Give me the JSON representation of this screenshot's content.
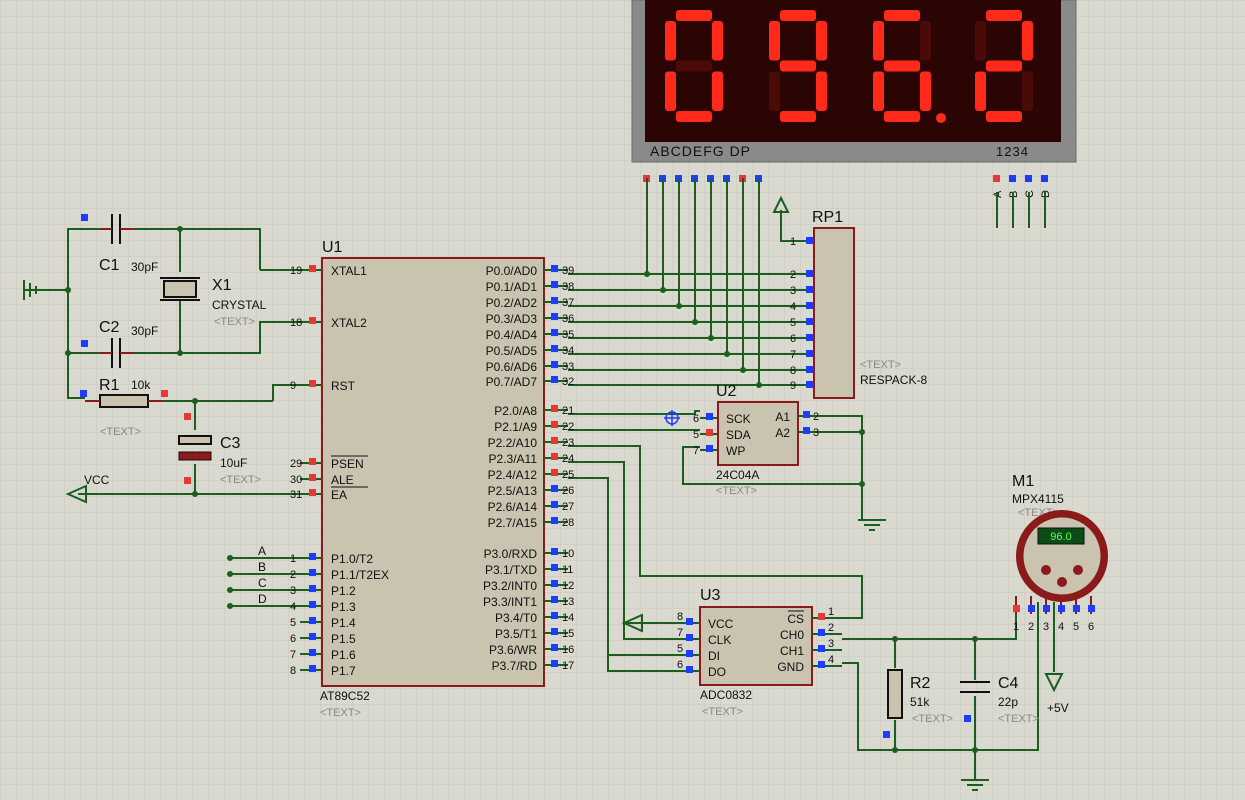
{
  "display": {
    "digits": [
      "0",
      "9",
      "6",
      "2"
    ],
    "seg_labels": "ABCDEFG  DP",
    "digit_labels": "1234",
    "com_pins": [
      "A",
      "B",
      "C",
      "D"
    ]
  },
  "u1": {
    "ref": "U1",
    "part": "AT89C52",
    "text": "<TEXT>",
    "left_pins": [
      {
        "num": "19",
        "name": "XTAL1"
      },
      {
        "num": "18",
        "name": "XTAL2"
      },
      {
        "num": "9",
        "name": "RST"
      },
      {
        "num": "29",
        "name": "PSEN"
      },
      {
        "num": "30",
        "name": "ALE"
      },
      {
        "num": "31",
        "name": "EA"
      },
      {
        "num": "1",
        "name": "P1.0/T2"
      },
      {
        "num": "2",
        "name": "P1.1/T2EX"
      },
      {
        "num": "3",
        "name": "P1.2"
      },
      {
        "num": "4",
        "name": "P1.3"
      },
      {
        "num": "5",
        "name": "P1.4"
      },
      {
        "num": "6",
        "name": "P1.5"
      },
      {
        "num": "7",
        "name": "P1.6"
      },
      {
        "num": "8",
        "name": "P1.7"
      }
    ],
    "right_pins": [
      {
        "num": "39",
        "name": "P0.0/AD0"
      },
      {
        "num": "38",
        "name": "P0.1/AD1"
      },
      {
        "num": "37",
        "name": "P0.2/AD2"
      },
      {
        "num": "36",
        "name": "P0.3/AD3"
      },
      {
        "num": "35",
        "name": "P0.4/AD4"
      },
      {
        "num": "34",
        "name": "P0.5/AD5"
      },
      {
        "num": "33",
        "name": "P0.6/AD6"
      },
      {
        "num": "32",
        "name": "P0.7/AD7"
      },
      {
        "num": "21",
        "name": "P2.0/A8"
      },
      {
        "num": "22",
        "name": "P2.1/A9"
      },
      {
        "num": "23",
        "name": "P2.2/A10"
      },
      {
        "num": "24",
        "name": "P2.3/A11"
      },
      {
        "num": "25",
        "name": "P2.4/A12"
      },
      {
        "num": "26",
        "name": "P2.5/A13"
      },
      {
        "num": "27",
        "name": "P2.6/A14"
      },
      {
        "num": "28",
        "name": "P2.7/A15"
      },
      {
        "num": "10",
        "name": "P3.0/RXD"
      },
      {
        "num": "11",
        "name": "P3.1/TXD"
      },
      {
        "num": "12",
        "name": "P3.2/INT0"
      },
      {
        "num": "13",
        "name": "P3.3/INT1"
      },
      {
        "num": "14",
        "name": "P3.4/T0"
      },
      {
        "num": "15",
        "name": "P3.5/T1"
      },
      {
        "num": "16",
        "name": "P3.6/WR"
      },
      {
        "num": "17",
        "name": "P3.7/RD"
      }
    ]
  },
  "p1_nets": [
    "A",
    "B",
    "C",
    "D"
  ],
  "x1": {
    "ref": "X1",
    "part": "CRYSTAL",
    "text": "<TEXT>"
  },
  "c1": {
    "ref": "C1",
    "value": "30pF"
  },
  "c2": {
    "ref": "C2",
    "value": "30pF"
  },
  "r1": {
    "ref": "R1",
    "value": "10k",
    "text": "<TEXT>"
  },
  "c3": {
    "ref": "C3",
    "value": "10uF",
    "text": "<TEXT>"
  },
  "vcc_label": "VCC",
  "rp1": {
    "ref": "RP1",
    "part": "RESPACK-8",
    "text": "<TEXT>",
    "pins": [
      "1",
      "2",
      "3",
      "4",
      "5",
      "6",
      "7",
      "8",
      "9"
    ]
  },
  "u2": {
    "ref": "U2",
    "part": "24C04A",
    "text": "<TEXT>",
    "left_pins": [
      {
        "num": "6",
        "name": "SCK"
      },
      {
        "num": "5",
        "name": "SDA"
      },
      {
        "num": "7",
        "name": "WP"
      }
    ],
    "right_pins": [
      {
        "num": "2",
        "name": "A1"
      },
      {
        "num": "3",
        "name": "A2"
      }
    ]
  },
  "u3": {
    "ref": "U3",
    "part": "ADC0832",
    "text": "<TEXT>",
    "left_pins": [
      {
        "num": "8",
        "name": "VCC"
      },
      {
        "num": "7",
        "name": "CLK"
      },
      {
        "num": "5",
        "name": "DI"
      },
      {
        "num": "6",
        "name": "DO"
      }
    ],
    "right_pins": [
      {
        "num": "1",
        "name": "CS"
      },
      {
        "num": "2",
        "name": "CH0"
      },
      {
        "num": "3",
        "name": "CH1"
      },
      {
        "num": "4",
        "name": "GND"
      }
    ]
  },
  "m1": {
    "ref": "M1",
    "part": "MPX4115",
    "text": "<TEXT>",
    "reading": "96.0",
    "pins": [
      "1",
      "2",
      "3",
      "4",
      "5",
      "6"
    ]
  },
  "r2": {
    "ref": "R2",
    "value": "51k",
    "text": "<TEXT>"
  },
  "c4": {
    "ref": "C4",
    "value": "22p",
    "text": "<TEXT>"
  },
  "plus5v": "+5V",
  "colors": {
    "grid_bg": "#d9d9cf",
    "grid_line": "#c6c6bb",
    "wire": "#1b5e20",
    "body_fill": "#c9c3b0",
    "body_stroke": "#8b1a1a",
    "segment_on": "#ff2a1a",
    "segment_off": "#4a0a08",
    "display_bg": "#8a8a8a",
    "pin_red": "#e53935",
    "pin_blue": "#1e3cff"
  }
}
